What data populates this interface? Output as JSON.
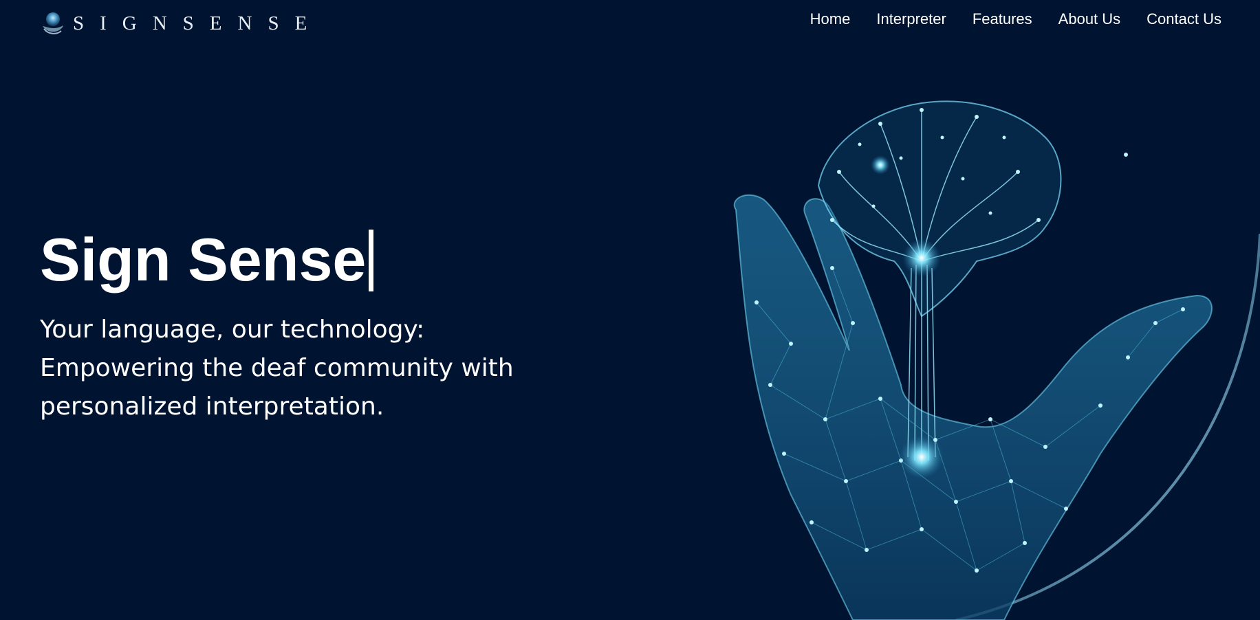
{
  "brand": {
    "logo_text": "SIGNSENSE",
    "logo_icon": "hand-globe-icon"
  },
  "nav": {
    "items": [
      {
        "label": "Home"
      },
      {
        "label": "Interpreter"
      },
      {
        "label": "Features"
      },
      {
        "label": "About Us"
      },
      {
        "label": "Contact Us"
      }
    ]
  },
  "hero": {
    "title": "Sign Sense",
    "subtitle_lines": [
      "Your language, our technology:",
      "Empowering the deaf community with",
      "personalized interpretation."
    ],
    "image": "glowing-network-hand-with-brain-illustration"
  },
  "colors": {
    "background": "#001432",
    "text": "#ffffff",
    "accent_glow": "#4fd6f2",
    "accent_deep": "#1b6fa0"
  }
}
